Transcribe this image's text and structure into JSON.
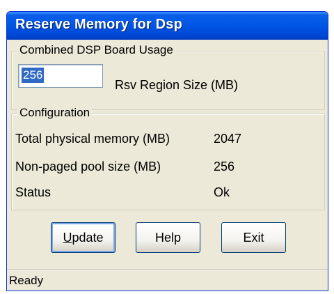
{
  "window": {
    "title": "Reserve Memory for Dsp"
  },
  "usage_group": {
    "label": "Combined DSP Board Usage",
    "rsv_region_input_value": "256",
    "rsv_region_label": "Rsv Region Size (MB)"
  },
  "config_group": {
    "label": "Configuration",
    "rows": [
      {
        "label": "Total physical memory (MB)",
        "value": "2047"
      },
      {
        "label": "Non-paged pool size (MB)",
        "value": "256"
      },
      {
        "label": "Status",
        "value": "Ok"
      }
    ]
  },
  "buttons": {
    "update_rest": "pdate",
    "update_accel": "U",
    "help": "Help",
    "exit": "Exit"
  },
  "statusbar": {
    "text": "Ready"
  },
  "colors": {
    "title_bar": "#0055e5",
    "window_face": "#ece9d8",
    "selection": "#316ac5"
  }
}
